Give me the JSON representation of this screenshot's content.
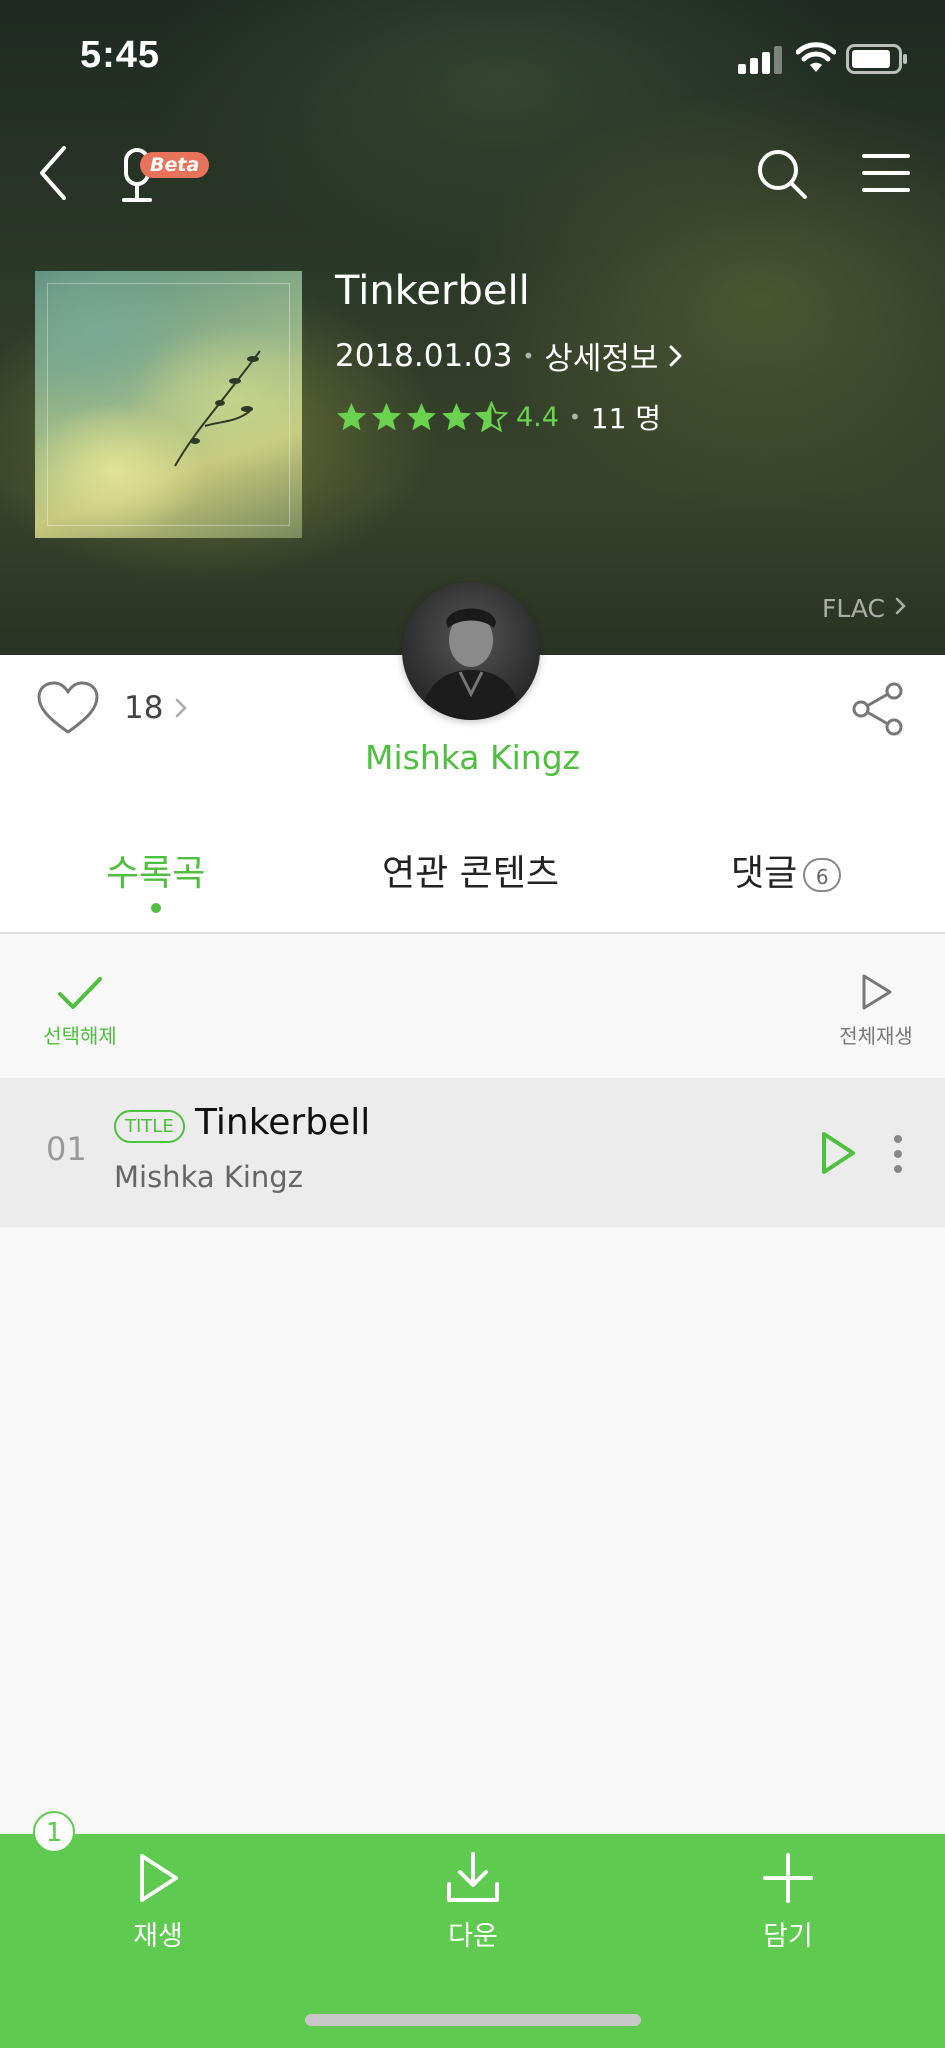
{
  "status_bar": {
    "time": "5:45"
  },
  "nav": {
    "beta_badge": "Beta"
  },
  "album": {
    "title": "Tinkerbell",
    "release_date": "2018.01.03",
    "detail_link": "상세정보",
    "rating_value": "4.4",
    "rating_stars": 4.4,
    "rating_count": "11 명",
    "quality": "FLAC"
  },
  "artist": {
    "name": "Mishka Kingz"
  },
  "like": {
    "count": "18"
  },
  "tabs": [
    {
      "label": "수록곡"
    },
    {
      "label": "연관 콘텐츠"
    },
    {
      "label": "댓글",
      "count": "6"
    }
  ],
  "toolbar": {
    "deselect_label": "선택해제",
    "play_all_label": "전체재생"
  },
  "tracks": [
    {
      "number": "01",
      "badge": "TITLE",
      "title": "Tinkerbell",
      "artist": "Mishka Kingz"
    }
  ],
  "bottom_bar": {
    "selected_count": "1",
    "play_label": "재생",
    "download_label": "다운",
    "add_label": "담기"
  },
  "colors": {
    "accent": "#4fbf3f",
    "bottom_bar": "#5fca50",
    "beta": "#e8735a"
  }
}
